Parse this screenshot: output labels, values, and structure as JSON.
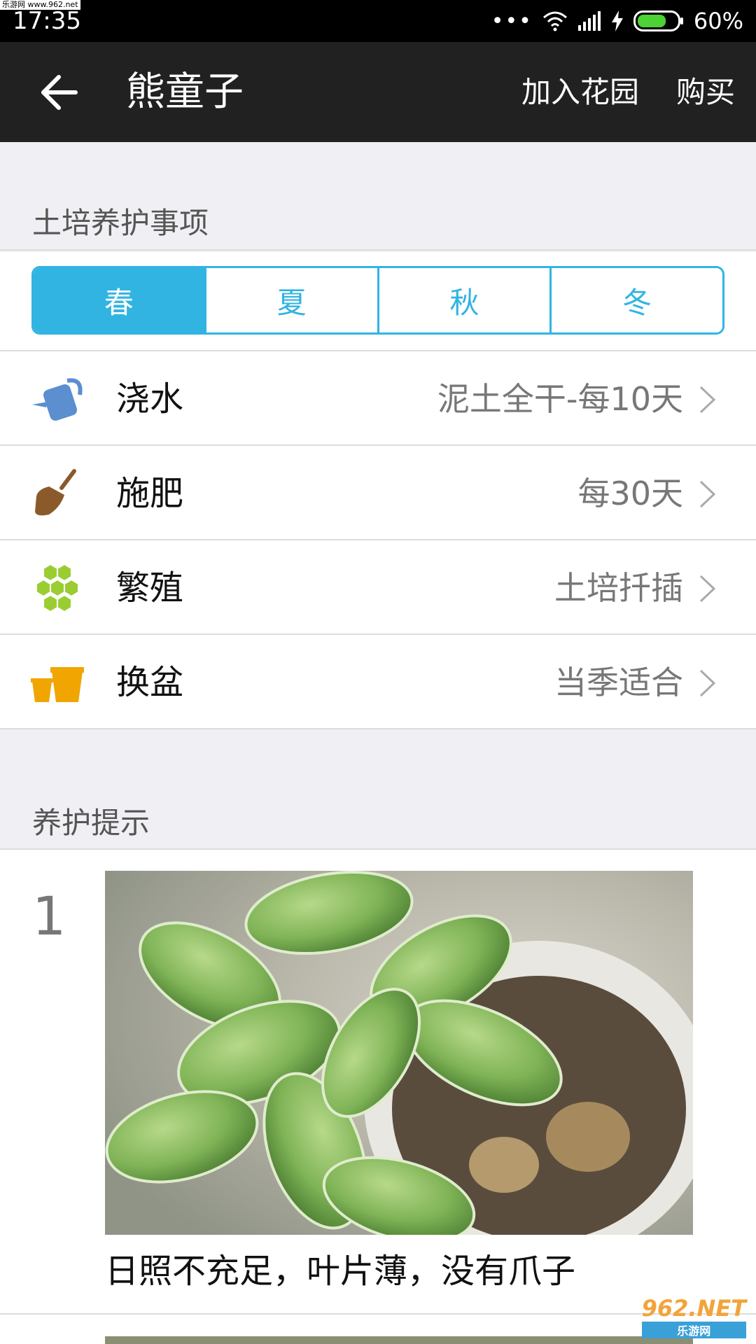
{
  "status_bar": {
    "watermark": "乐游网 www.962.net",
    "time": "17:35",
    "signal_dots": "•••",
    "battery": "60%"
  },
  "app_bar": {
    "title": "熊童子",
    "add_garden": "加入花园",
    "buy": "购买"
  },
  "soil_care": {
    "header": "土培养护事项",
    "seasons": [
      "春",
      "夏",
      "秋",
      "冬"
    ],
    "active_season": "春",
    "items": [
      {
        "label": "浇水",
        "value": "泥土全干-每10天",
        "icon": "watering-can-icon"
      },
      {
        "label": "施肥",
        "value": "每30天",
        "icon": "trowel-icon"
      },
      {
        "label": "繁殖",
        "value": "土培扦插",
        "icon": "hexagon-cluster-icon"
      },
      {
        "label": "换盆",
        "value": "当季适合",
        "icon": "flower-pot-icon"
      }
    ]
  },
  "tips": {
    "header": "养护提示",
    "items": [
      {
        "number": "1",
        "caption": "日照不充足，叶片薄，没有爪子"
      }
    ]
  },
  "watermark": {
    "brand": "962.NET",
    "sub": "乐游网"
  },
  "colors": {
    "accent": "#31b4e2",
    "app_bar": "#212121",
    "water_icon": "#5b8fd0",
    "fertilize_icon": "#8b5a2b",
    "propagate_icon": "#9acd32",
    "repot_icon": "#f0a500"
  }
}
